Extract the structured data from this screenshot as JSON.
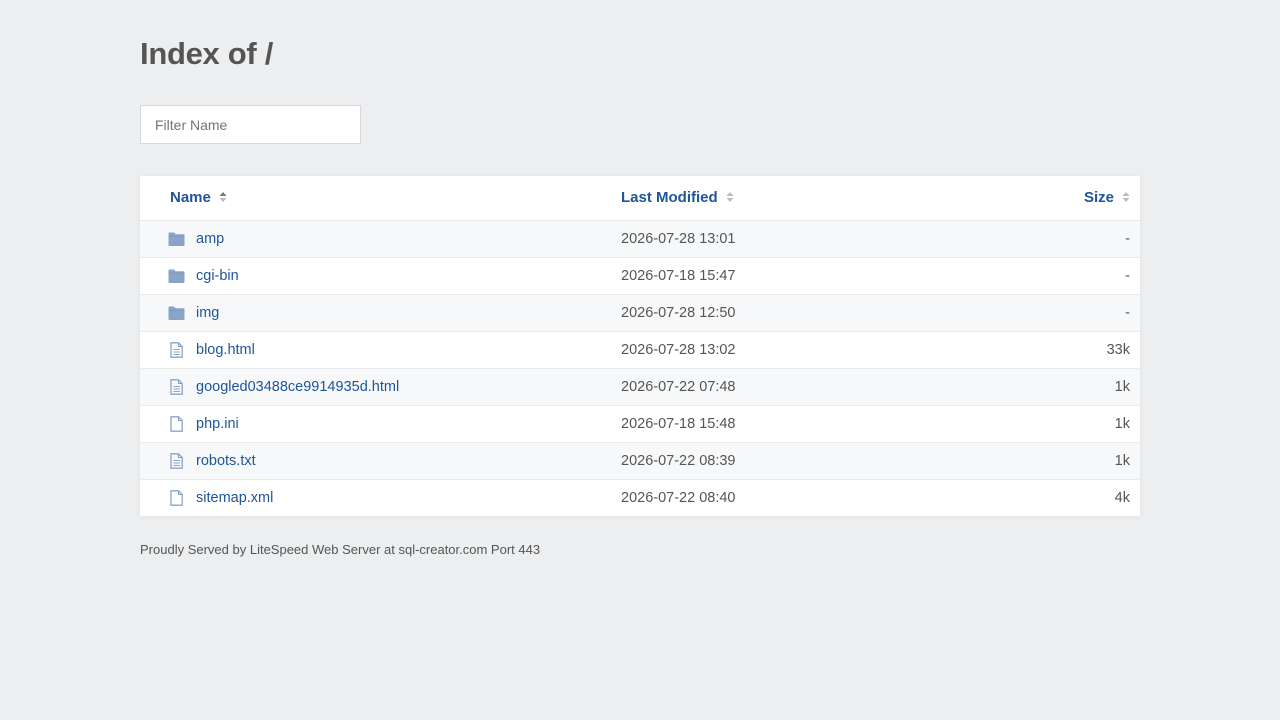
{
  "page": {
    "title": "Index of /"
  },
  "filter": {
    "placeholder": "Filter Name",
    "value": ""
  },
  "columns": {
    "name": "Name",
    "modified": "Last Modified",
    "size": "Size"
  },
  "colors": {
    "link": "#1f5599",
    "folder": "#8aa4c8",
    "file": "#8aa4c8"
  },
  "rows": [
    {
      "type": "folder",
      "icon": "folder-icon",
      "name": "amp",
      "modified": "2026-07-28 13:01",
      "size": "-"
    },
    {
      "type": "folder",
      "icon": "folder-icon",
      "name": "cgi-bin",
      "modified": "2026-07-18 15:47",
      "size": "-"
    },
    {
      "type": "folder",
      "icon": "folder-icon",
      "name": "img",
      "modified": "2026-07-28 12:50",
      "size": "-"
    },
    {
      "type": "text",
      "icon": "text-file-icon",
      "name": "blog.html",
      "modified": "2026-07-28 13:02",
      "size": "33k"
    },
    {
      "type": "text",
      "icon": "text-file-icon",
      "name": "googled03488ce9914935d.html",
      "modified": "2026-07-22 07:48",
      "size": "1k"
    },
    {
      "type": "file",
      "icon": "file-icon",
      "name": "php.ini",
      "modified": "2026-07-18 15:48",
      "size": "1k"
    },
    {
      "type": "text",
      "icon": "text-file-icon",
      "name": "robots.txt",
      "modified": "2026-07-22 08:39",
      "size": "1k"
    },
    {
      "type": "file",
      "icon": "file-icon",
      "name": "sitemap.xml",
      "modified": "2026-07-22 08:40",
      "size": "4k"
    }
  ],
  "footer": {
    "text": "Proudly Served by LiteSpeed Web Server at sql-creator.com Port 443"
  }
}
